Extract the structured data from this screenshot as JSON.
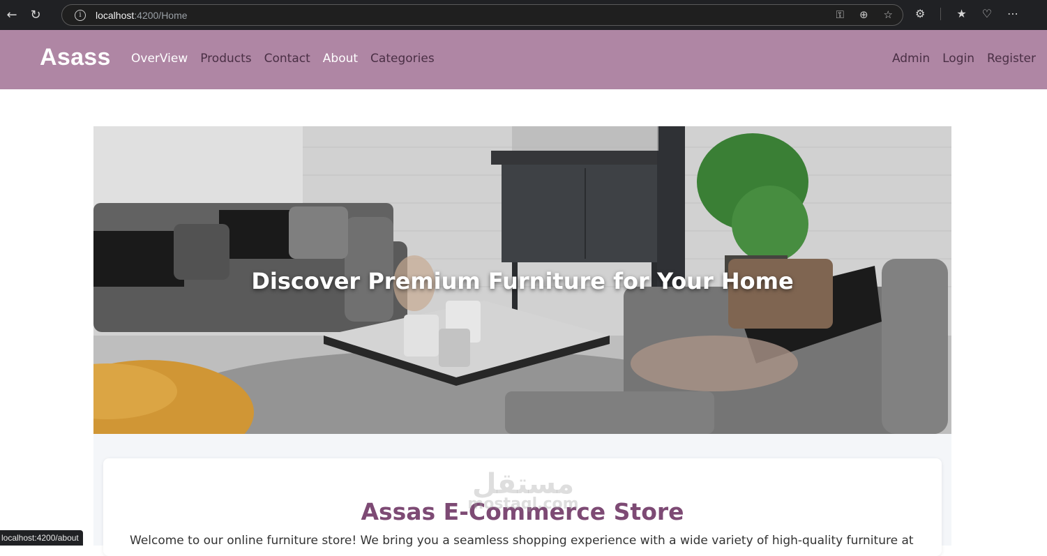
{
  "browser": {
    "url_host": "localhost",
    "url_path": ":4200/Home",
    "status_link": "localhost:4200/about"
  },
  "navbar": {
    "brand": "Asass",
    "links": [
      "OverView",
      "Products",
      "Contact",
      "About",
      "Categories"
    ],
    "right_links": [
      "Admin",
      "Login",
      "Register"
    ],
    "bg_color": "#af86a4"
  },
  "hero": {
    "title": "Discover Premium Furniture for Your Home"
  },
  "about_card": {
    "title": "Assas E-Commerce Store",
    "text": "Welcome to our online furniture store! We bring you a seamless shopping experience with a wide variety of high-quality furniture at",
    "title_color": "#7d4a74"
  },
  "watermark": {
    "arabic": "مستقل",
    "latin": "mostaql.com"
  }
}
